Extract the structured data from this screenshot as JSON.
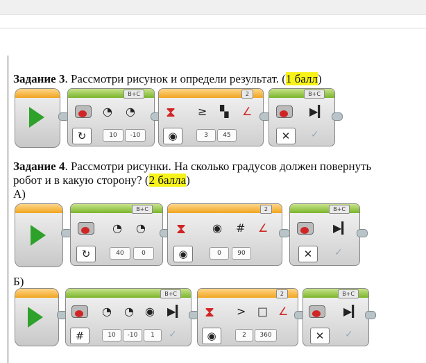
{
  "task3": {
    "label": "Задание 3",
    "text": ". Рассмотри рисунок и определи результат. (",
    "points": "1 балл",
    "close": ")",
    "program": {
      "move_block": {
        "port": "B+C",
        "mode_icon": "rotate-icon",
        "values": [
          "10",
          "-10"
        ]
      },
      "wait_block": {
        "port": "2",
        "values": [
          "3",
          "45"
        ]
      },
      "stop_block": {
        "port": "B+C",
        "mode_icon": "off-icon"
      }
    }
  },
  "task4": {
    "label": "Задание 4",
    "line1": ". Рассмотри рисунки. На сколько градусов должен повернуть",
    "line2_prefix": "робот и в какую сторону? (",
    "points": "2 балла",
    "close": ")",
    "variant_a": {
      "label": "А)",
      "move_block": {
        "port": "B+C",
        "values": [
          "40",
          "0"
        ]
      },
      "wait_block": {
        "port": "2",
        "values": [
          "0",
          "90"
        ]
      },
      "stop_block": {
        "port": "B+C"
      }
    },
    "variant_b": {
      "label": "Б)",
      "move_block": {
        "port": "B+C",
        "values": [
          "10",
          "-10",
          "1"
        ],
        "mode_symbol": "#"
      },
      "wait_block": {
        "port": "2",
        "values": [
          "2",
          "360"
        ]
      },
      "stop_block": {
        "port": "B+C"
      }
    }
  },
  "symbols": {
    "check": "✓",
    "cross": "✕",
    "rotate": "↻",
    "gte": "≥",
    "gt": ">",
    "hash": "#",
    "degree_mode": "#"
  }
}
